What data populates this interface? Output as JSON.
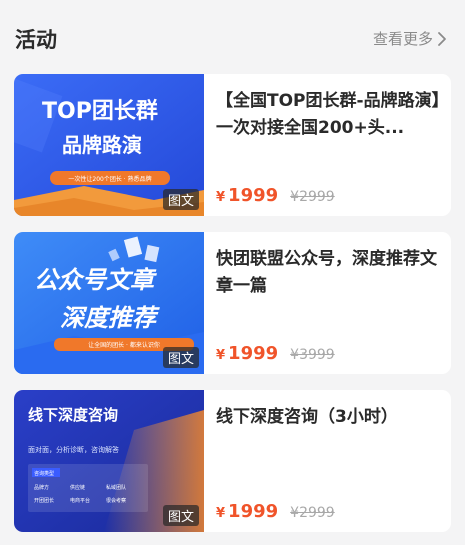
{
  "header": {
    "title": "活动",
    "more_label": "查看更多"
  },
  "cards": [
    {
      "title": "【全国TOP团长群-品牌路演】一次对接全国200+头...",
      "badge": "图文",
      "currency": "¥",
      "price": "1999",
      "original_price": "¥2999",
      "thumb": {
        "line1": "TOP团长群",
        "line2": "品牌路演",
        "tag": "一次性让200个团长 · 熟悉品牌"
      }
    },
    {
      "title": "快团联盟公众号，深度推荐文章一篇",
      "badge": "图文",
      "currency": "¥",
      "price": "1999",
      "original_price": "¥3999",
      "thumb": {
        "line1": "公众号文章",
        "line2": "深度推荐",
        "tag": "让全国的团长 · 都来认识你"
      }
    },
    {
      "title": "线下深度咨询（3小时）",
      "badge": "图文",
      "currency": "¥",
      "price": "1999",
      "original_price": "¥2999",
      "thumb": {
        "line1": "线下深度咨询",
        "line2": "面对面，分析诊断，咨询解答",
        "box_title": "咨询类型",
        "box_items": [
          "品牌方",
          "供应链",
          "私域团队",
          "开团团长",
          "电商平台",
          "很会考察"
        ]
      }
    }
  ],
  "colors": {
    "price": "#f0542a",
    "banner_blue": "#2e5ef0",
    "accent_orange": "#f29a3c"
  }
}
